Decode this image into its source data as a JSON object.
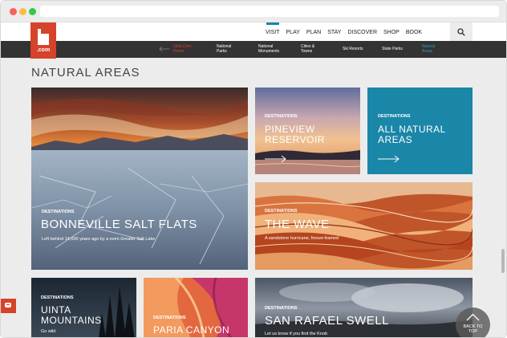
{
  "colors": {
    "brand_red": "#d6432b",
    "accent_teal": "#1a86a8",
    "subnav_bg": "#333333"
  },
  "header": {
    "logo_text": ".com",
    "main_nav": [
      "VISIT",
      "PLAY",
      "PLAN",
      "STAY",
      "DISCOVER",
      "SHOP",
      "BOOK"
    ],
    "active_nav": "VISIT",
    "search_icon": "search-icon"
  },
  "subnav": {
    "back_line1": "Utah.Com",
    "back_line2": "Home",
    "items": [
      {
        "line1": "National",
        "line2": "Parks"
      },
      {
        "line1": "National",
        "line2": "Monuments"
      },
      {
        "line1": "Cities &",
        "line2": "Towns"
      },
      {
        "line1": "Ski Resorts",
        "line2": ""
      },
      {
        "line1": "State Parks",
        "line2": ""
      },
      {
        "line1": "Natural",
        "line2": "Areas"
      }
    ]
  },
  "page_title": "NATURAL AREAS",
  "tiles": {
    "bonneville": {
      "category": "DESTINATIONS",
      "name": "BONNEVILLE SALT FLATS",
      "desc": "Left behind 14,000 years ago by a even Greater Salt Lake"
    },
    "pineview": {
      "category": "DESTINATIONS",
      "name_line1": "PINEVIEW",
      "name_line2": "RESERVOIR"
    },
    "all_natural": {
      "category": "DESTINATIONS",
      "name_line1": "ALL NATURAL",
      "name_line2": "AREAS"
    },
    "wave": {
      "category": "DESTINATIONS",
      "name": "THE WAVE",
      "desc": "A sandstone hurricane, freeze-framed"
    },
    "uinta": {
      "category": "DESTINATIONS",
      "name_line1": "UINTA",
      "name_line2": "MOUNTAINS",
      "desc": "Go wild"
    },
    "paria": {
      "category": "DESTINATIONS",
      "name": "PARIA CANYON"
    },
    "san_rafael": {
      "category": "DESTINATIONS",
      "name": "SAN RAFAEL SWELL",
      "desc": "Let us know if you find the Knob"
    }
  },
  "back_to_top": {
    "line1": "BACK TO",
    "line2": "TOP"
  }
}
